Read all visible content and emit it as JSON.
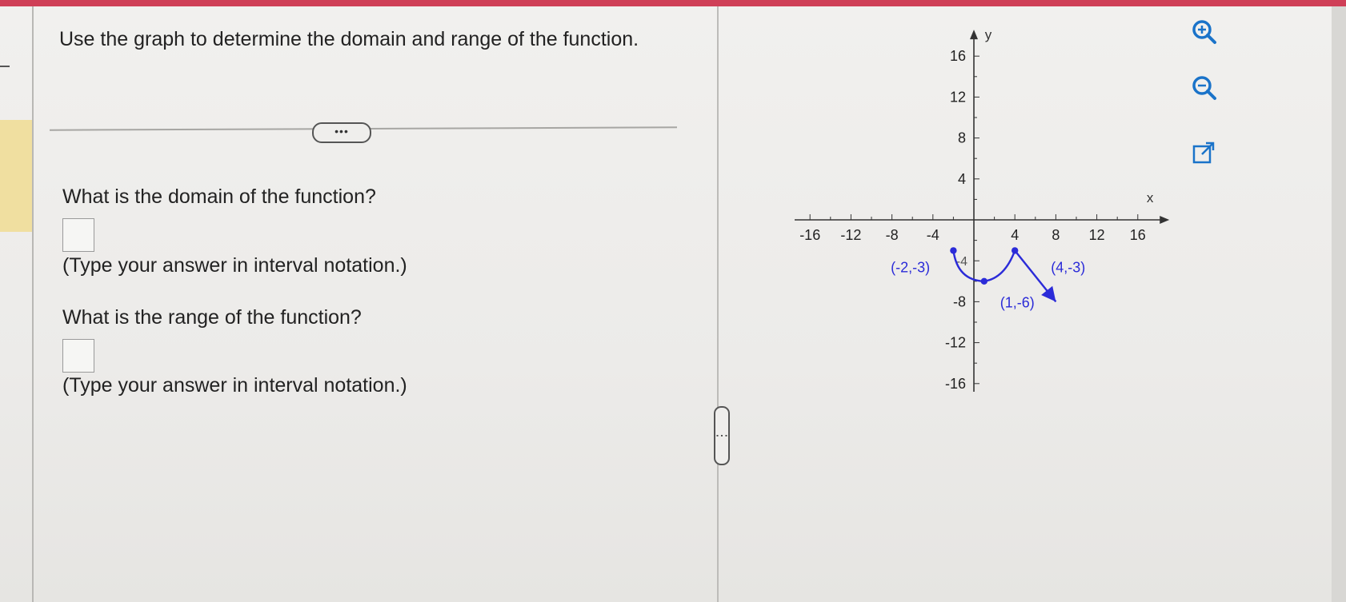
{
  "question": {
    "prompt": "Use the graph to determine the domain and range of the function.",
    "more_label": "•••",
    "domain_question": "What is the domain of the function?",
    "domain_hint": "(Type your answer in interval notation.)",
    "range_question": "What is the range of the function?",
    "range_hint": "(Type your answer in interval notation.)",
    "domain_value": "",
    "range_value": ""
  },
  "divider_handle_label": "⋮",
  "tools": {
    "zoom_in": "zoom-in-icon",
    "zoom_out": "zoom-out-icon",
    "popout": "external-link-icon"
  },
  "graph": {
    "x_label": "x",
    "y_label": "y",
    "x_ticks": [
      -16,
      -12,
      -8,
      -4,
      4,
      8,
      12,
      16
    ],
    "y_ticks": [
      16,
      12,
      8,
      4,
      -8,
      -12,
      -16
    ],
    "y_tick_overlap_label": "-4",
    "curve_color": "#2b2bd8",
    "points": [
      {
        "x": -2,
        "y": -3,
        "label": "(-2,-3)"
      },
      {
        "x": 1,
        "y": -6,
        "label": "(1,-6)"
      },
      {
        "x": 4,
        "y": -3,
        "label": "(4,-3)"
      }
    ],
    "arrow_end": {
      "x": 8,
      "y": -8
    }
  }
}
